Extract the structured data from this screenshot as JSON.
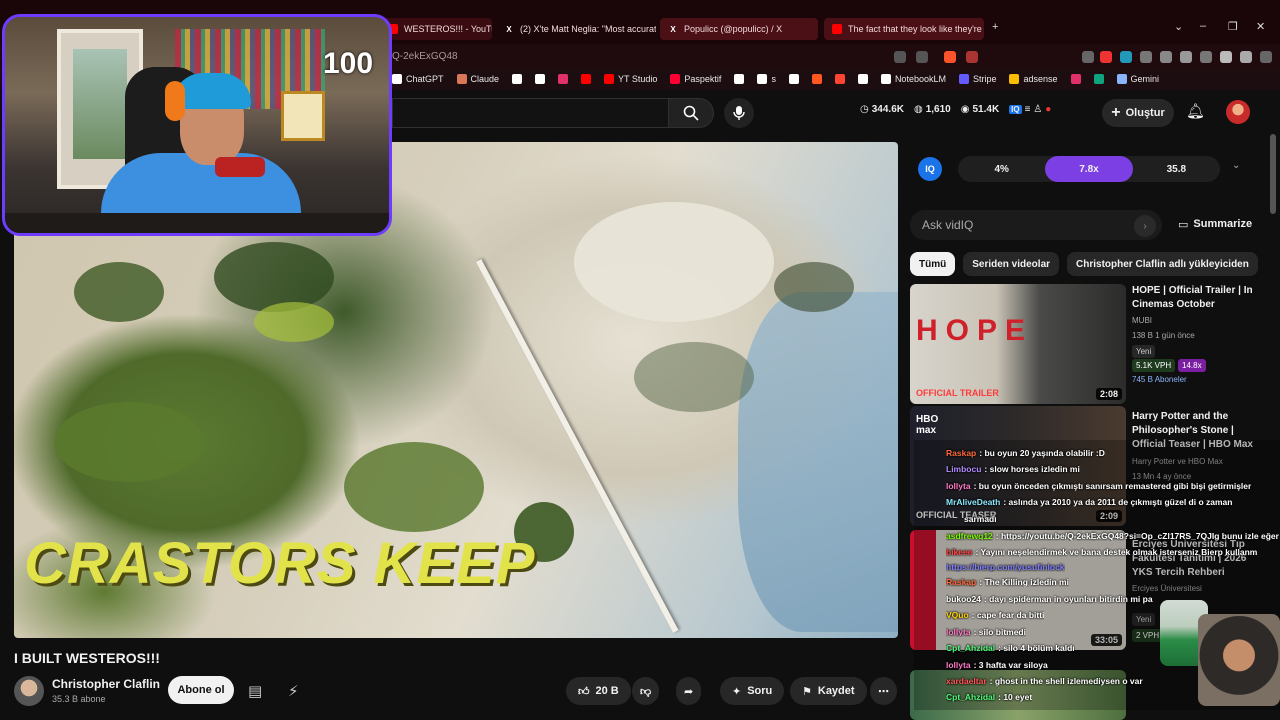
{
  "browser": {
    "tabs": [
      {
        "label": "WESTEROS!!! - YouTube",
        "favicon_color": "#ff0000",
        "favicon": ""
      },
      {
        "label": "(2) X'te Matt Neglia: \"Most accurate",
        "favicon_color": "#000000",
        "favicon": "X"
      },
      {
        "label": "Populicc (@populicc) / X",
        "favicon_color": "#000000",
        "favicon": "X"
      },
      {
        "label": "The fact that they look like they're tr",
        "favicon_color": "#ff0000",
        "favicon": ""
      }
    ],
    "close_glyph": "×",
    "newtab_glyph": "+",
    "address": "Q-2ekExGQ48",
    "bookmarks": [
      {
        "label": "ChatGPT",
        "color": "#ffffff"
      },
      {
        "label": "Claude",
        "color": "#d97757"
      },
      {
        "label": "",
        "color": "#ffffff"
      },
      {
        "label": "",
        "color": "#ffffff"
      },
      {
        "label": "",
        "color": "#e1306c"
      },
      {
        "label": "",
        "color": "#ff0000"
      },
      {
        "label": "YT Studio",
        "color": "#ff0000"
      },
      {
        "label": "Paspektif",
        "color": "#ff0033"
      },
      {
        "label": "",
        "color": "#ffffff"
      },
      {
        "label": "s",
        "color": "#ffffff"
      },
      {
        "label": "",
        "color": "#ffffff"
      },
      {
        "label": "",
        "color": "#ff5722"
      },
      {
        "label": "",
        "color": "#ff4433"
      },
      {
        "label": "",
        "color": "#ffffff"
      },
      {
        "label": "NotebookLM",
        "color": "#ffffff"
      },
      {
        "label": "Stripe",
        "color": "#635bff"
      },
      {
        "label": "adsense",
        "color": "#fbbc04"
      },
      {
        "label": "",
        "color": "#e1306c"
      },
      {
        "label": "",
        "color": "#10a37f"
      },
      {
        "label": "Gemini",
        "color": "#8ab4f8"
      }
    ]
  },
  "yt_header": {
    "stats": [
      {
        "icon": "clock-icon",
        "value": "344.6K"
      },
      {
        "icon": "chat-icon",
        "value": "1,610"
      },
      {
        "icon": "eye-icon",
        "value": "51.4K"
      }
    ],
    "create_label": "Oluştur"
  },
  "webcam": {
    "counter": "100"
  },
  "video": {
    "overlay_text": "CRASTORS KEEP",
    "title": "I BUILT WESTEROS!!!",
    "channel": "Christopher Claflin",
    "subscribers": "35.3 B abone",
    "subscribe_label": "Abone ol",
    "likes": "20 B",
    "ask_label": "Soru",
    "save_label": "Kaydet"
  },
  "vidiq": {
    "logo": "IQ",
    "metrics": [
      "4%",
      "7.8x",
      "35.8"
    ],
    "ask_placeholder": "Ask vidIQ",
    "summarize_label": "Summarize"
  },
  "filters": [
    "Tümü",
    "Seriden videolar",
    "Christopher Claflin adlı yükleyiciden"
  ],
  "recommended": [
    {
      "title": "HOPE | Official Trailer | In Cinemas October",
      "channel": "MUBI",
      "meta": "138 B  1 gün önce",
      "tag": "Yeni",
      "vph": "5.1K VPH",
      "mult": "14.8x",
      "subs_gain": "745 B Aboneler",
      "duration": "2:08",
      "thumb_word": "HOPE",
      "thumb_label": "OFFICIAL TRAILER"
    },
    {
      "title": "Harry Potter and the Philosopher's Stone | Official Teaser | HBO Max",
      "channel": "Harry Potter  ve HBO Max",
      "meta": "13 Mn   4 ay önce",
      "duration": "2:09",
      "thumb_logo": "HBO max",
      "thumb_label": "OFFICIAL TEASER"
    },
    {
      "title": "Erciyes Üniversitesi Tıp Fakültesi Tanıtımı | 2026 YKS Tercih Rehberi",
      "channel": "Erciyes Üniversitesi",
      "tag": "Yeni",
      "vph": "2 VPH",
      "duration": "33:05"
    }
  ],
  "chat": [
    {
      "user": "Raskap",
      "text": ": bu oyun 20 yaşında olabilir :D",
      "color": "#ff6a3d"
    },
    {
      "user": "Limbocu",
      "text": ": slow horses izledin mi",
      "color": "#b18cff"
    },
    {
      "user": "lollyta",
      "text": ": bu oyun önceden çıkmıştı sanırsam remastered gibi bişi getirmişler",
      "color": "#ff79c6"
    },
    {
      "user": "MrAliveDeath",
      "text": ": aslında ya 2010 ya da 2011 de çıkmıştı güzel di o zaman",
      "color": "#8be9fd"
    },
    {
      "user": "",
      "text": "sarmadı",
      "color": "#ffffff"
    },
    {
      "user": "asdfrewq12",
      "text": ": https://youtu.be/Q-2ekExGQ48?si=Op_cZl17RS_7QJIg bunu izle eğer",
      "color": "#7CFC00"
    },
    {
      "user": "bikeee",
      "text": ": Yayını neşelendirmek ve bana destek olmak isterseniz Bierp kullanm",
      "color": "#ff4444"
    },
    {
      "user": "",
      "text": "https://bierp.com/yusufinlock",
      "color": "#7f7fff"
    },
    {
      "user": "Raskap",
      "text": ": The Killing izledin mi",
      "color": "#ff6a3d"
    },
    {
      "user": "bukoo24",
      "text": ": dayı spiderman in oyunları bitirdin mi pa",
      "color": "#ffffff"
    },
    {
      "user": "VQuo",
      "text": ": cape fear da bitti",
      "color": "#ffd500"
    },
    {
      "user": "lollyta",
      "text": ": silo bitmedi",
      "color": "#ff79c6"
    },
    {
      "user": "Cpt_Ahzidal",
      "text": ": silo 4 bölüm kaldı",
      "color": "#50fa7b"
    },
    {
      "user": "lollyta",
      "text": ": 3 hafta var siloya",
      "color": "#ff79c6"
    },
    {
      "user": "xardaeltar",
      "text": ": ghost in the shell izlemediysen o var",
      "color": "#ff5555"
    },
    {
      "user": "Cpt_Ahzidal",
      "text": ": 10 eyet",
      "color": "#50fa7b"
    }
  ]
}
